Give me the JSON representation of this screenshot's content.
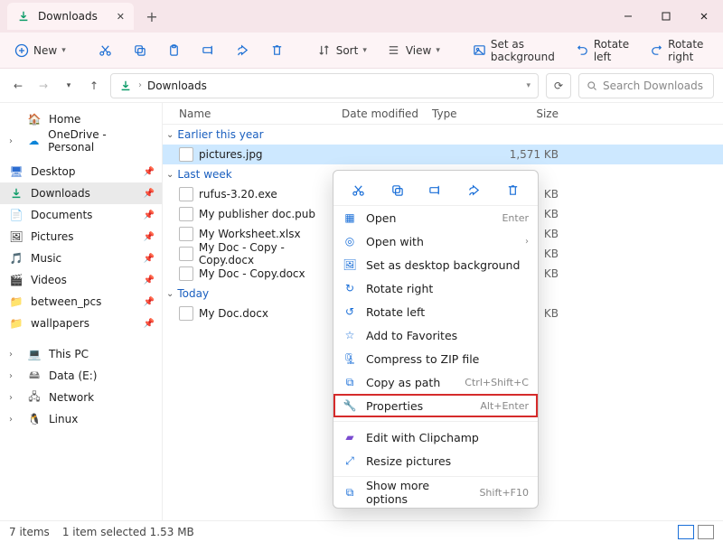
{
  "window": {
    "title": "Downloads",
    "minimize": "–",
    "maximize": "□",
    "close": "✕"
  },
  "tab": {
    "label": "Downloads",
    "close": "✕",
    "add": "+"
  },
  "toolbar": {
    "new": "New",
    "sort": "Sort",
    "view": "View",
    "set_bg": "Set as background",
    "rotate_left": "Rotate left",
    "rotate_right": "Rotate right"
  },
  "address": {
    "crumb": "Downloads",
    "refresh": "⟳",
    "search_placeholder": "Search Downloads"
  },
  "sidebar": {
    "home": "Home",
    "onedrive": "OneDrive - Personal",
    "desktop": "Desktop",
    "downloads": "Downloads",
    "documents": "Documents",
    "pictures": "Pictures",
    "music": "Music",
    "videos": "Videos",
    "between_pcs": "between_pcs",
    "wallpapers": "wallpapers",
    "this_pc": "This PC",
    "data_e": "Data (E:)",
    "network": "Network",
    "linux": "Linux"
  },
  "columns": {
    "name": "Name",
    "date": "Date modified",
    "type": "Type",
    "size": "Size"
  },
  "groups": {
    "g0": {
      "label": "Earlier this year"
    },
    "g1": {
      "label": "Last week"
    },
    "g2": {
      "label": "Today"
    }
  },
  "files": {
    "f0": {
      "name": "pictures.jpg",
      "date": "",
      "type": "",
      "size": "1,571 KB"
    },
    "f1": {
      "name": "rufus-3.20.exe",
      "size": "KB"
    },
    "f2": {
      "name": "My publisher doc.pub",
      "size": "KB"
    },
    "f3": {
      "name": "My Worksheet.xlsx",
      "size": "KB"
    },
    "f4": {
      "name": "My Doc - Copy - Copy.docx",
      "size": "KB"
    },
    "f5": {
      "name": "My Doc - Copy.docx",
      "size": "KB"
    },
    "f6": {
      "name": "My Doc.docx",
      "size": "KB"
    }
  },
  "context": {
    "open": "Open",
    "open_sc": "Enter",
    "open_with": "Open with",
    "set_bg": "Set as desktop background",
    "rotate_right": "Rotate right",
    "rotate_left": "Rotate left",
    "favorites": "Add to Favorites",
    "compress": "Compress to ZIP file",
    "copy_path": "Copy as path",
    "copy_path_sc": "Ctrl+Shift+C",
    "properties": "Properties",
    "properties_sc": "Alt+Enter",
    "clipchamp": "Edit with Clipchamp",
    "resize": "Resize pictures",
    "more": "Show more options",
    "more_sc": "Shift+F10"
  },
  "status": {
    "count": "7 items",
    "selection": "1 item selected  1.53 MB"
  }
}
